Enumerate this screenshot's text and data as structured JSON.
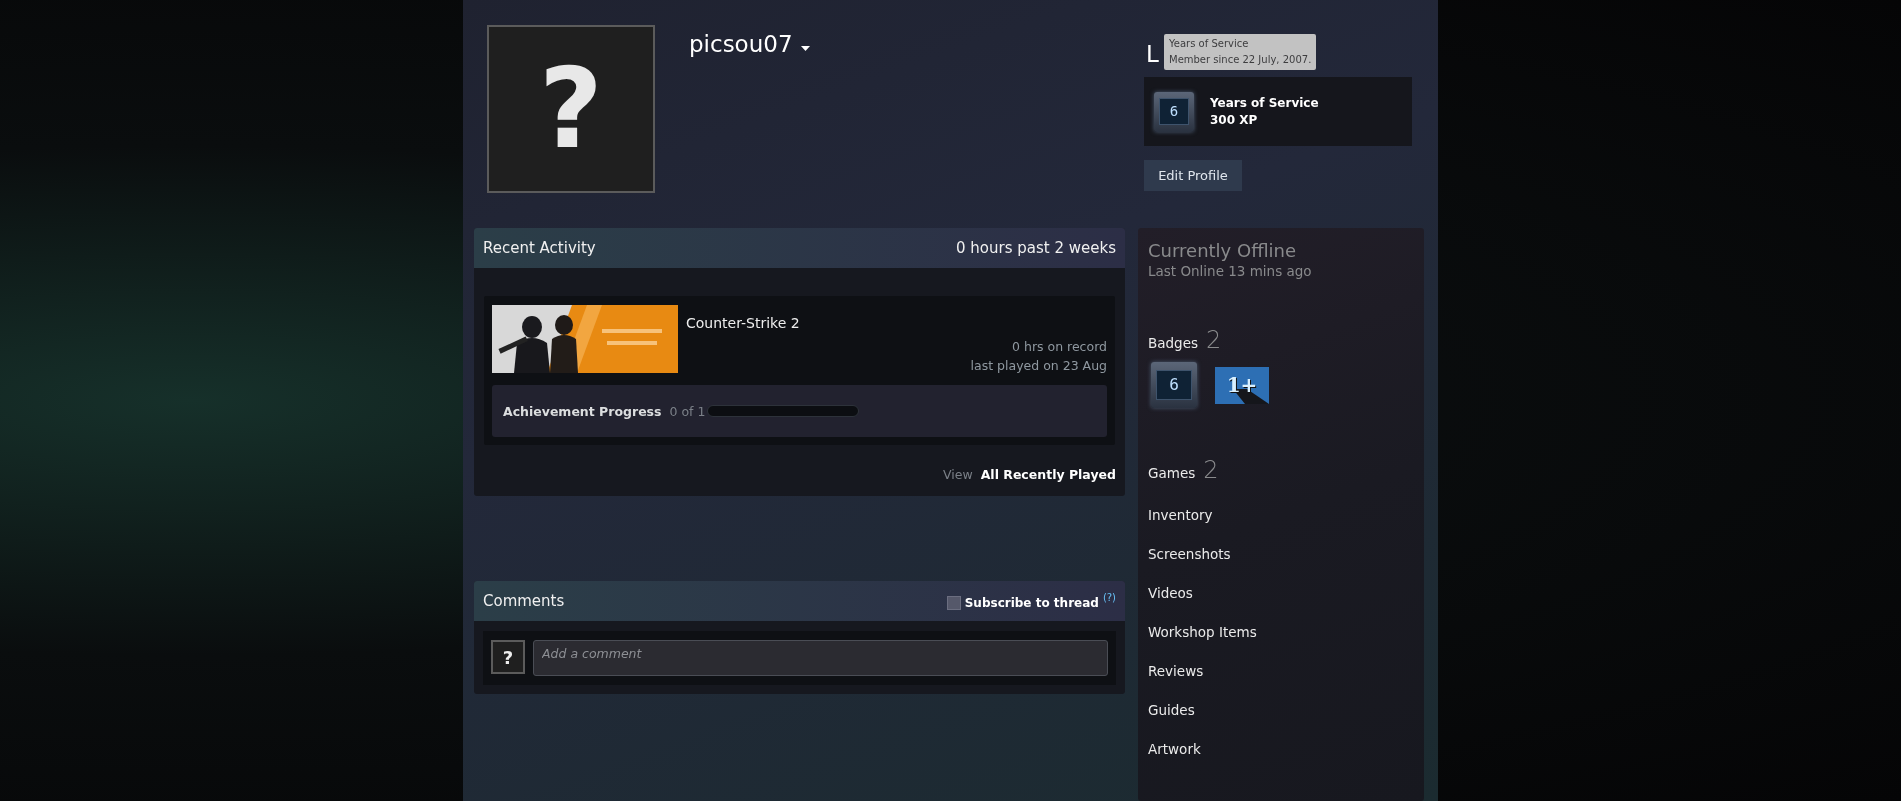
{
  "profile": {
    "avatar": "?",
    "name": "picsou07",
    "level_label": "L",
    "tooltip": {
      "title": "Years of Service",
      "text": "Member since 22 July, 2007."
    },
    "featured_badge": {
      "icon_text": "6",
      "name": "Years of Service",
      "xp": "300 XP"
    },
    "edit_button": "Edit Profile"
  },
  "recent_activity": {
    "title": "Recent Activity",
    "hours": "0 hours past 2 weeks",
    "games": [
      {
        "name": "Counter-Strike 2",
        "hours": "0 hrs on record",
        "last_played": "last played on 23 Aug",
        "achievement_label": "Achievement Progress",
        "achievement_count": "0 of 1",
        "level": 0
      }
    ],
    "view_label": "View",
    "view_link": "All Recently Played"
  },
  "comments": {
    "title": "Comments",
    "subscribe": {
      "label": "Subscribe to thread",
      "checked": false
    },
    "help": "(?)",
    "avatar": "?",
    "placeholder": "Add a comment"
  },
  "sidebar": {
    "status": "Currently Offline",
    "last_online": "Last Online 13 mins ago",
    "badges": {
      "label": "Badges",
      "count": "2",
      "items": [
        {
          "kind": "years",
          "text": "6"
        },
        {
          "kind": "plus",
          "text": "1+"
        }
      ]
    },
    "links": [
      {
        "label": "Games",
        "count": "2"
      },
      {
        "label": "Inventory"
      },
      {
        "label": "Screenshots"
      },
      {
        "label": "Videos"
      },
      {
        "label": "Workshop Items"
      },
      {
        "label": "Reviews"
      },
      {
        "label": "Guides"
      },
      {
        "label": "Artwork"
      }
    ]
  }
}
